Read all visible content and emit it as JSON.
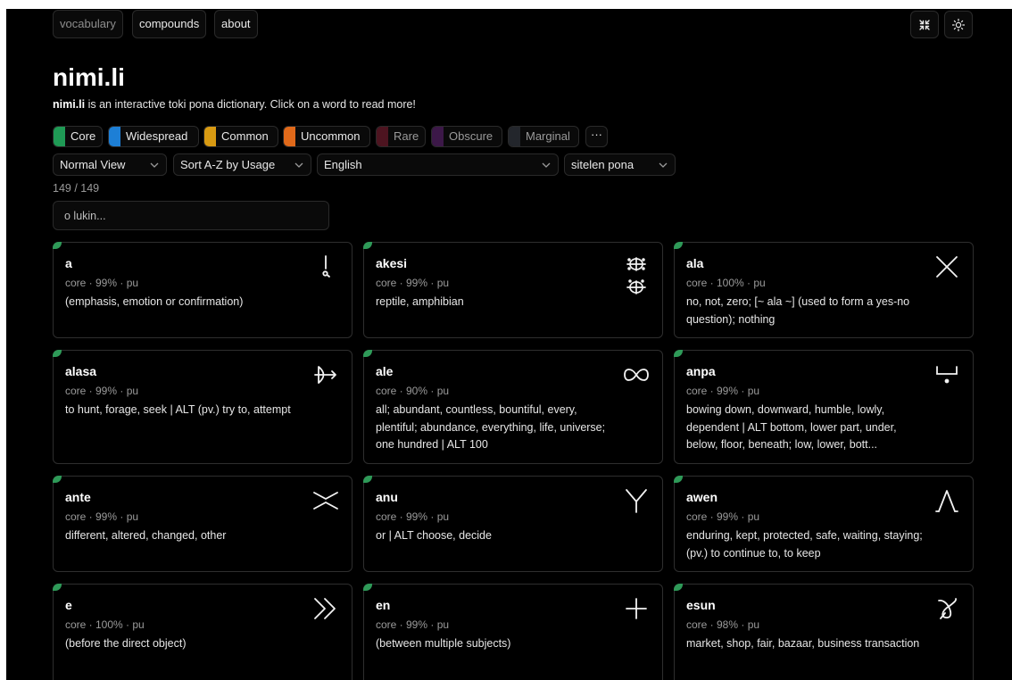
{
  "nav": {
    "tabs": [
      {
        "label": "vocabulary"
      },
      {
        "label": "compounds"
      },
      {
        "label": "about"
      }
    ],
    "collapse_icon": "collapse-icon",
    "theme_icon": "sun-icon"
  },
  "header": {
    "title": "nimi.li",
    "intro_brand": "nimi.li",
    "intro_text": " is an interactive toki pona dictionary. Click on a word to read more!"
  },
  "filters": {
    "chips": [
      {
        "label": "Core",
        "color": "#1f9a55",
        "dim": false
      },
      {
        "label": "Widespread",
        "color": "#1d7fd6",
        "dim": false
      },
      {
        "label": "Common",
        "color": "#d89a12",
        "dim": false
      },
      {
        "label": "Uncommon",
        "color": "#e0691a",
        "dim": false
      },
      {
        "label": "Rare",
        "color": "#4d1420",
        "dim": true
      },
      {
        "label": "Obscure",
        "color": "#3c1848",
        "dim": true
      },
      {
        "label": "Marginal",
        "color": "#23262c",
        "dim": true
      }
    ],
    "more_label": "···"
  },
  "controls": {
    "view": "Normal View",
    "sort": "Sort A-Z by Usage",
    "language": "English",
    "script": "sitelen pona"
  },
  "count": "149 / 149",
  "search": {
    "placeholder": "o lukin...",
    "value": ""
  },
  "words": [
    {
      "word": "a",
      "meta": "core · 99% · pu",
      "definition": "(emphasis, emotion or confirmation)",
      "glyph": "a-glyph-icon"
    },
    {
      "word": "akesi",
      "meta": "core · 99% · pu",
      "definition": "reptile, amphibian",
      "glyph": "akesi-glyph-icon"
    },
    {
      "word": "ala",
      "meta": "core · 100% · pu",
      "definition": "no, not, zero; [~ ala ~] (used to form a yes-no question); nothing",
      "glyph": "ala-glyph-icon"
    },
    {
      "word": "alasa",
      "meta": "core · 99% · pu",
      "definition": "to hunt, forage, seek | ALT (pv.) try to, attempt",
      "glyph": "alasa-glyph-icon"
    },
    {
      "word": "ale",
      "meta": "core · 90% · pu",
      "definition": "all; abundant, countless, bountiful, every, plentiful; abundance, everything, life, universe; one hundred | ALT 100",
      "glyph": "ale-glyph-icon"
    },
    {
      "word": "anpa",
      "meta": "core · 99% · pu",
      "definition": "bowing down, downward, humble, lowly, dependent | ALT bottom, lower part, under, below, floor, beneath; low, lower, bott...",
      "glyph": "anpa-glyph-icon"
    },
    {
      "word": "ante",
      "meta": "core · 99% · pu",
      "definition": "different, altered, changed, other",
      "glyph": "ante-glyph-icon"
    },
    {
      "word": "anu",
      "meta": "core · 99% · pu",
      "definition": "or | ALT choose, decide",
      "glyph": "anu-glyph-icon"
    },
    {
      "word": "awen",
      "meta": "core · 99% · pu",
      "definition": "enduring, kept, protected, safe, waiting, staying; (pv.) to continue to, to keep",
      "glyph": "awen-glyph-icon"
    },
    {
      "word": "e",
      "meta": "core · 100% · pu",
      "definition": "(before the direct object)",
      "glyph": "e-glyph-icon"
    },
    {
      "word": "en",
      "meta": "core · 99% · pu",
      "definition": "(between multiple subjects)",
      "glyph": "en-glyph-icon"
    },
    {
      "word": "esun",
      "meta": "core · 98% · pu",
      "definition": "market, shop, fair, bazaar, business transaction",
      "glyph": "esun-glyph-icon"
    }
  ]
}
